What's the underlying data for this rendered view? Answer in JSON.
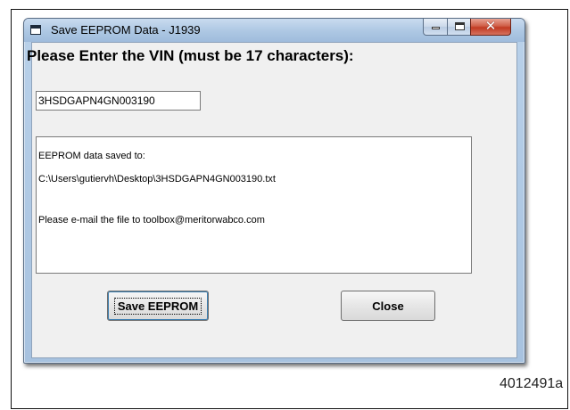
{
  "window": {
    "title": "Save EEPROM Data - J1939",
    "controls": {
      "minimize_icon": "minimize-icon",
      "maximize_icon": "maximize-icon",
      "close_icon": "close-icon",
      "close_glyph": "✕"
    }
  },
  "form": {
    "heading": "Please Enter the VIN (must be 17 characters):",
    "vin_value": "3HSDGAPN4GN003190",
    "output_lines": [
      "EEPROM data saved to:",
      "C:\\Users\\gutiervh\\Desktop\\3HSDGAPN4GN003190.txt",
      "",
      "Please e-mail the file to toolbox@meritorwabco.com"
    ]
  },
  "buttons": {
    "save_label": "Save EEPROM",
    "close_label": "Close"
  },
  "figure_id": "4012491a",
  "colors": {
    "title_bar": "#b9d1ea",
    "close_button": "#c23a22",
    "client_bg": "#f0f0f0",
    "focus_ring": "#3c7fb1"
  }
}
